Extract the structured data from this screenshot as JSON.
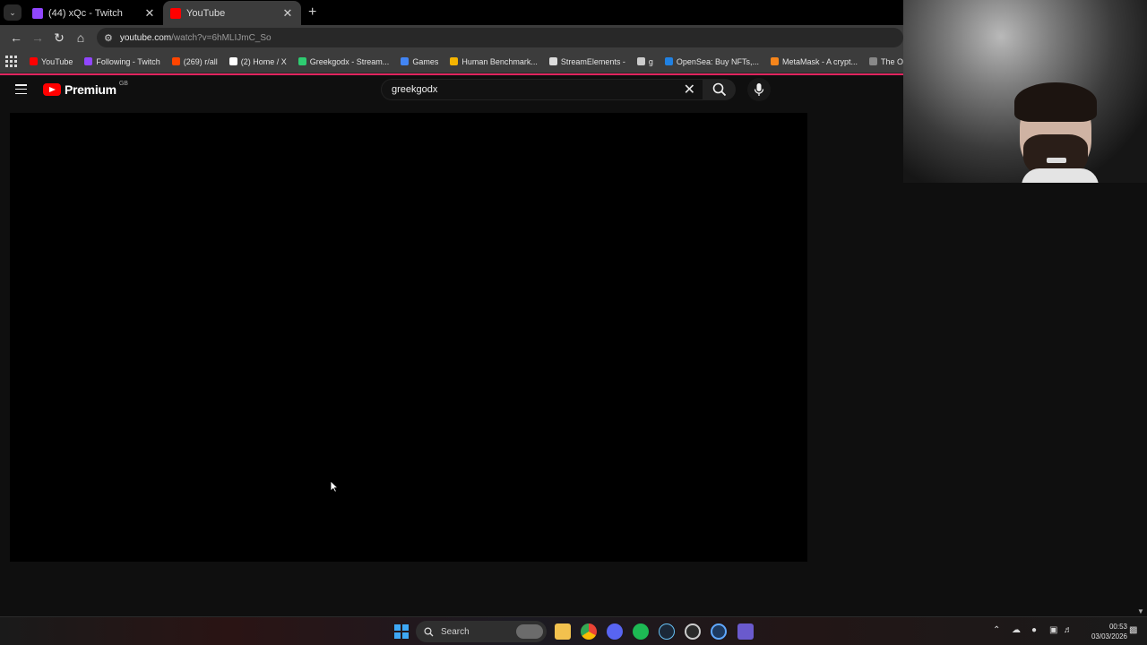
{
  "browser": {
    "tabs": [
      {
        "title": "(44) xQc - Twitch",
        "favicon_color": "#9146ff",
        "active": false
      },
      {
        "title": "YouTube",
        "favicon_color": "#ff0000",
        "active": true
      }
    ],
    "url_host": "youtube.com",
    "url_path": "/watch?v=6hMLIJmC_So",
    "bookmarks": [
      {
        "label": "YouTube",
        "color": "#ff0000"
      },
      {
        "label": "Following - Twitch",
        "color": "#9146ff"
      },
      {
        "label": "(269) r/all",
        "color": "#ff4500"
      },
      {
        "label": "(2) Home / X",
        "color": "#ffffff"
      },
      {
        "label": "Greekgodx - Stream...",
        "color": "#2ecc71"
      },
      {
        "label": "Games",
        "color": "#4285f4"
      },
      {
        "label": "Human Benchmark...",
        "color": "#f4b400"
      },
      {
        "label": "StreamElements -",
        "color": "#dddddd"
      },
      {
        "label": "g",
        "color": "#cccccc"
      },
      {
        "label": "OpenSea: Buy NFTs,...",
        "color": "#2081e2"
      },
      {
        "label": "MetaMask - A crypt...",
        "color": "#f6851b"
      },
      {
        "label": "The Osbournes - Se...",
        "color": "#888888"
      }
    ],
    "accent_line_color": "#e0245e"
  },
  "youtube": {
    "logo_text": "Premium",
    "region": "GB",
    "search_query": "greekgodx"
  },
  "taskbar": {
    "search_label": "Search",
    "time": "00:53",
    "date": "03/03/2026"
  }
}
